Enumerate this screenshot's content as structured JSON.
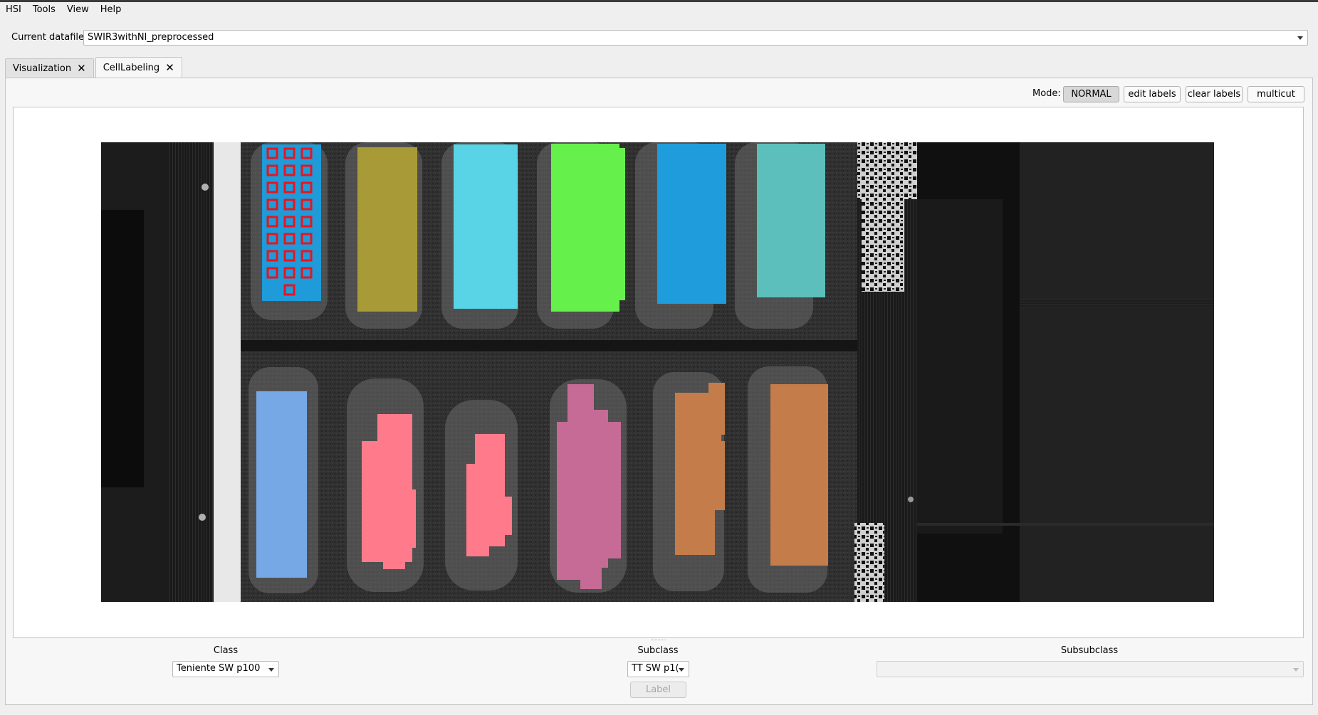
{
  "menu": {
    "items": [
      "HSI",
      "Tools",
      "View",
      "Help"
    ]
  },
  "datafile": {
    "label": "Current datafile",
    "value": "SWIR3withNI_preprocessed"
  },
  "tabs": [
    {
      "label": "Visualization",
      "active": false
    },
    {
      "label": "CellLabeling",
      "active": true
    }
  ],
  "toolbar": {
    "mode_label": "Mode:",
    "normal": "NORMAL",
    "edit_labels": "edit labels",
    "clear_labels": "clear labels",
    "multicut": "multicut"
  },
  "labeling": {
    "class_label": "Class",
    "class_value": "Teniente SW p100",
    "subclass_label": "Subclass",
    "subclass_value": "TT SW p1(",
    "subsubclass_label": "Subsubclass",
    "subsubclass_value": "",
    "label_button": "Label"
  },
  "colors": {
    "blue_grid": "#1e9bd8",
    "olive": "#a99a38",
    "cyan": "#59d3e6",
    "green": "#66f04c",
    "blue": "#1f9cdb",
    "teal": "#5cbfbb",
    "light_blue": "#77a8e6",
    "pink": "#ff7b8b",
    "mauve": "#c56b95",
    "orange": "#c47c4b",
    "grid_red": "#e8141e"
  }
}
